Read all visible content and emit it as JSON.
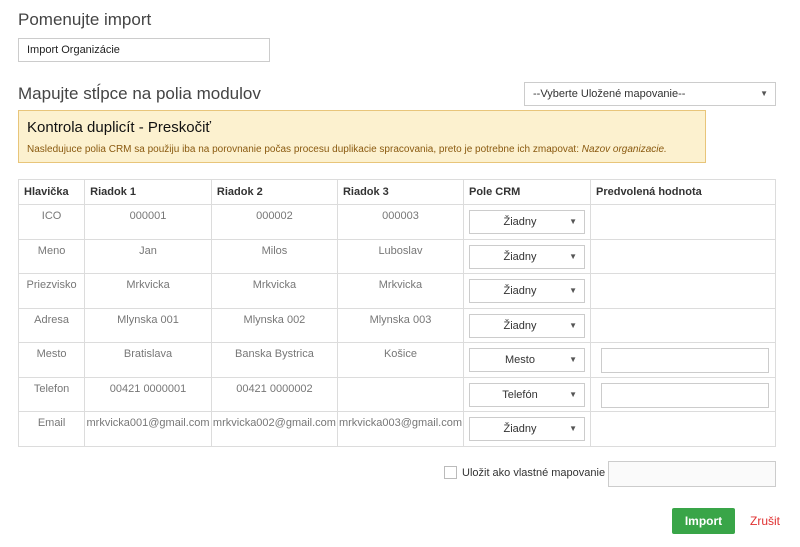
{
  "header": {
    "title": "Pomenujte import",
    "import_name_value": "Import Organizácie"
  },
  "mapping": {
    "title": "Mapujte stĺpce na polia modulov",
    "saved_mapping_select": "--Vyberte Uložené mapovanie--"
  },
  "warning": {
    "title": "Kontrola duplicít - Preskočiť",
    "text": "Nasledujuce polia CRM sa použiju iba na porovnanie počas procesu duplikacie spracovania, preto je potrebne ich zmapovat: ",
    "field": "Nazov organizacie."
  },
  "table": {
    "headers": [
      "Hlavička",
      "Riadok 1",
      "Riadok 2",
      "Riadok 3",
      "Pole CRM",
      "Predvolená hodnota"
    ],
    "rows": [
      {
        "header": "ICO",
        "row1": "000001",
        "row2": "000002",
        "row3": "000003",
        "pole": "Žiadny",
        "default": false
      },
      {
        "header": "Meno",
        "row1": "Jan",
        "row2": "Milos",
        "row3": "Luboslav",
        "pole": "Žiadny",
        "default": false
      },
      {
        "header": "Priezvisko",
        "row1": "Mrkvicka",
        "row2": "Mrkvicka",
        "row3": "Mrkvicka",
        "pole": "Žiadny",
        "default": false
      },
      {
        "header": "Adresa",
        "row1": "Mlynska 001",
        "row2": "Mlynska 002",
        "row3": "Mlynska 003",
        "pole": "Žiadny",
        "default": false
      },
      {
        "header": "Mesto",
        "row1": "Bratislava",
        "row2": "Banska Bystrica",
        "row3": "Košice",
        "pole": "Mesto",
        "default": true
      },
      {
        "header": "Telefon",
        "row1": "00421 0000001",
        "row2": "00421 0000002",
        "row3": "",
        "pole": "Telefón",
        "default": true
      },
      {
        "header": "Email",
        "row1": "mrkvicka001@gmail.com",
        "row2": "mrkvicka002@gmail.com",
        "row3": "mrkvicka003@gmail.com",
        "pole": "Žiadny",
        "default": false
      }
    ]
  },
  "footer": {
    "save_mapping_label": "Uložit ako vlastné mapovanie",
    "import_button": "Import",
    "cancel_link": "Zrušit"
  },
  "colors": {
    "import_button": "#39a548",
    "cancel_link": "#e03030",
    "warning_bg": "#fcf1cf"
  },
  "icons": {
    "select_arrow": "caret-down-icon"
  }
}
